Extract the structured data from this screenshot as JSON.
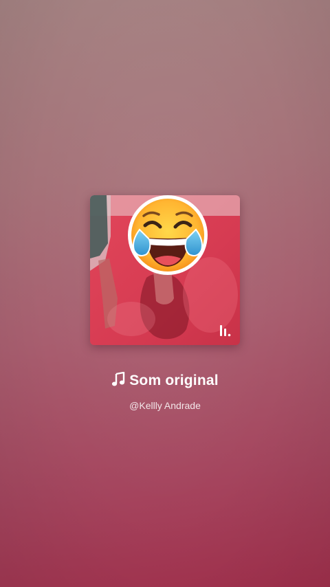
{
  "sound": {
    "title": "Som original",
    "author": "@Kellly Andrade",
    "cover_icon": "laughing-with-tears-emoji",
    "brand_icon": "kwai-logo-icon",
    "title_icon": "music-note-icon"
  },
  "colors": {
    "background_top": "#a48282",
    "background_bottom": "#a3304d",
    "text": "#ffffff"
  }
}
